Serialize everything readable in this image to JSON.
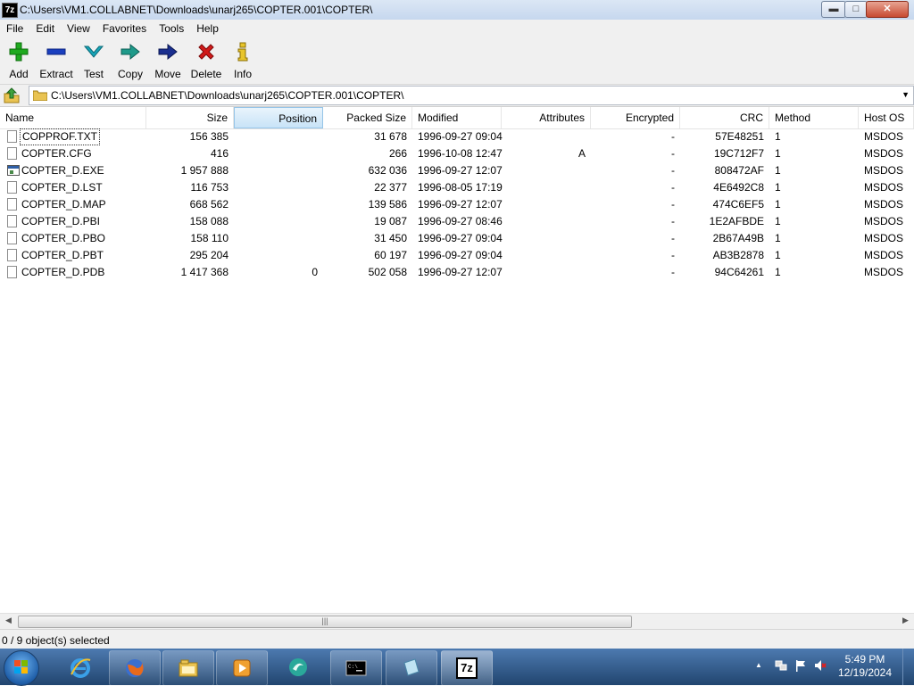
{
  "window": {
    "title": "C:\\Users\\VM1.COLLABNET\\Downloads\\unarj265\\COPTER.001\\COPTER\\",
    "app_icon_label": "7z",
    "minimize": "▬",
    "maximize": "□",
    "close": "✕"
  },
  "menu": [
    "File",
    "Edit",
    "View",
    "Favorites",
    "Tools",
    "Help"
  ],
  "toolbar": [
    {
      "label": "Add",
      "icon": "plus-icon",
      "color": "#1faa1f"
    },
    {
      "label": "Extract",
      "icon": "minus-icon",
      "color": "#1a3fbf"
    },
    {
      "label": "Test",
      "icon": "checkmark-icon",
      "color": "#18a5b8"
    },
    {
      "label": "Copy",
      "icon": "copy-arrow-icon",
      "color": "#1e9a8a"
    },
    {
      "label": "Move",
      "icon": "move-arrow-icon",
      "color": "#1a2f8f"
    },
    {
      "label": "Delete",
      "icon": "delete-x-icon",
      "color": "#d11a1a"
    },
    {
      "label": "Info",
      "icon": "info-icon",
      "color": "#b99a10"
    }
  ],
  "address": {
    "path": "C:\\Users\\VM1.COLLABNET\\Downloads\\unarj265\\COPTER.001\\COPTER\\",
    "dropdown_glyph": "▼"
  },
  "columns": [
    "Name",
    "Size",
    "Position",
    "Packed Size",
    "Modified",
    "Attributes",
    "Encrypted",
    "CRC",
    "Method",
    "Host OS"
  ],
  "sorted_column": "Position",
  "files": [
    {
      "name": "COPPROF.TXT",
      "size": "156 385",
      "position": "",
      "packed": "31 678",
      "modified": "1996-09-27 09:04",
      "attributes": "",
      "encrypted": "-",
      "crc": "57E48251",
      "method": "1",
      "host_os": "MSDOS",
      "type": "doc"
    },
    {
      "name": "COPTER.CFG",
      "size": "416",
      "position": "",
      "packed": "266",
      "modified": "1996-10-08 12:47",
      "attributes": "A",
      "encrypted": "-",
      "crc": "19C712F7",
      "method": "1",
      "host_os": "MSDOS",
      "type": "doc"
    },
    {
      "name": "COPTER_D.EXE",
      "size": "1 957 888",
      "position": "",
      "packed": "632 036",
      "modified": "1996-09-27 12:07",
      "attributes": "",
      "encrypted": "-",
      "crc": "808472AF",
      "method": "1",
      "host_os": "MSDOS",
      "type": "exe"
    },
    {
      "name": "COPTER_D.LST",
      "size": "116 753",
      "position": "",
      "packed": "22 377",
      "modified": "1996-08-05 17:19",
      "attributes": "",
      "encrypted": "-",
      "crc": "4E6492C8",
      "method": "1",
      "host_os": "MSDOS",
      "type": "doc"
    },
    {
      "name": "COPTER_D.MAP",
      "size": "668 562",
      "position": "",
      "packed": "139 586",
      "modified": "1996-09-27 12:07",
      "attributes": "",
      "encrypted": "-",
      "crc": "474C6EF5",
      "method": "1",
      "host_os": "MSDOS",
      "type": "doc"
    },
    {
      "name": "COPTER_D.PBI",
      "size": "158 088",
      "position": "",
      "packed": "19 087",
      "modified": "1996-09-27 08:46",
      "attributes": "",
      "encrypted": "-",
      "crc": "1E2AFBDE",
      "method": "1",
      "host_os": "MSDOS",
      "type": "doc"
    },
    {
      "name": "COPTER_D.PBO",
      "size": "158 110",
      "position": "",
      "packed": "31 450",
      "modified": "1996-09-27 09:04",
      "attributes": "",
      "encrypted": "-",
      "crc": "2B67A49B",
      "method": "1",
      "host_os": "MSDOS",
      "type": "doc"
    },
    {
      "name": "COPTER_D.PBT",
      "size": "295 204",
      "position": "",
      "packed": "60 197",
      "modified": "1996-09-27 09:04",
      "attributes": "",
      "encrypted": "-",
      "crc": "AB3B2878",
      "method": "1",
      "host_os": "MSDOS",
      "type": "doc"
    },
    {
      "name": "COPTER_D.PDB",
      "size": "1 417 368",
      "position": "0",
      "packed": "502 058",
      "modified": "1996-09-27 12:07",
      "attributes": "",
      "encrypted": "-",
      "crc": "94C64261",
      "method": "1",
      "host_os": "MSDOS",
      "type": "doc"
    }
  ],
  "scrollbar": {
    "left_arrow": "◀",
    "right_arrow": "▶",
    "grip": "|||"
  },
  "status": "0 / 9 object(s) selected",
  "taskbar": {
    "apps": [
      "internet-explorer-icon",
      "firefox-icon",
      "file-explorer-icon",
      "media-player-icon",
      "app-swirl-icon",
      "command-prompt-icon",
      "notepad-icon",
      "7zip-icon"
    ],
    "seven_zip_label": "7z",
    "cmd_label": "C:\\",
    "time": "5:49 PM",
    "date": "12/19/2024",
    "tray_arrow": "▲"
  },
  "colors": {
    "titlebar": "#c6d7ee",
    "taskbar": "#2b5282",
    "sorted_header": "#c8e3f7"
  }
}
